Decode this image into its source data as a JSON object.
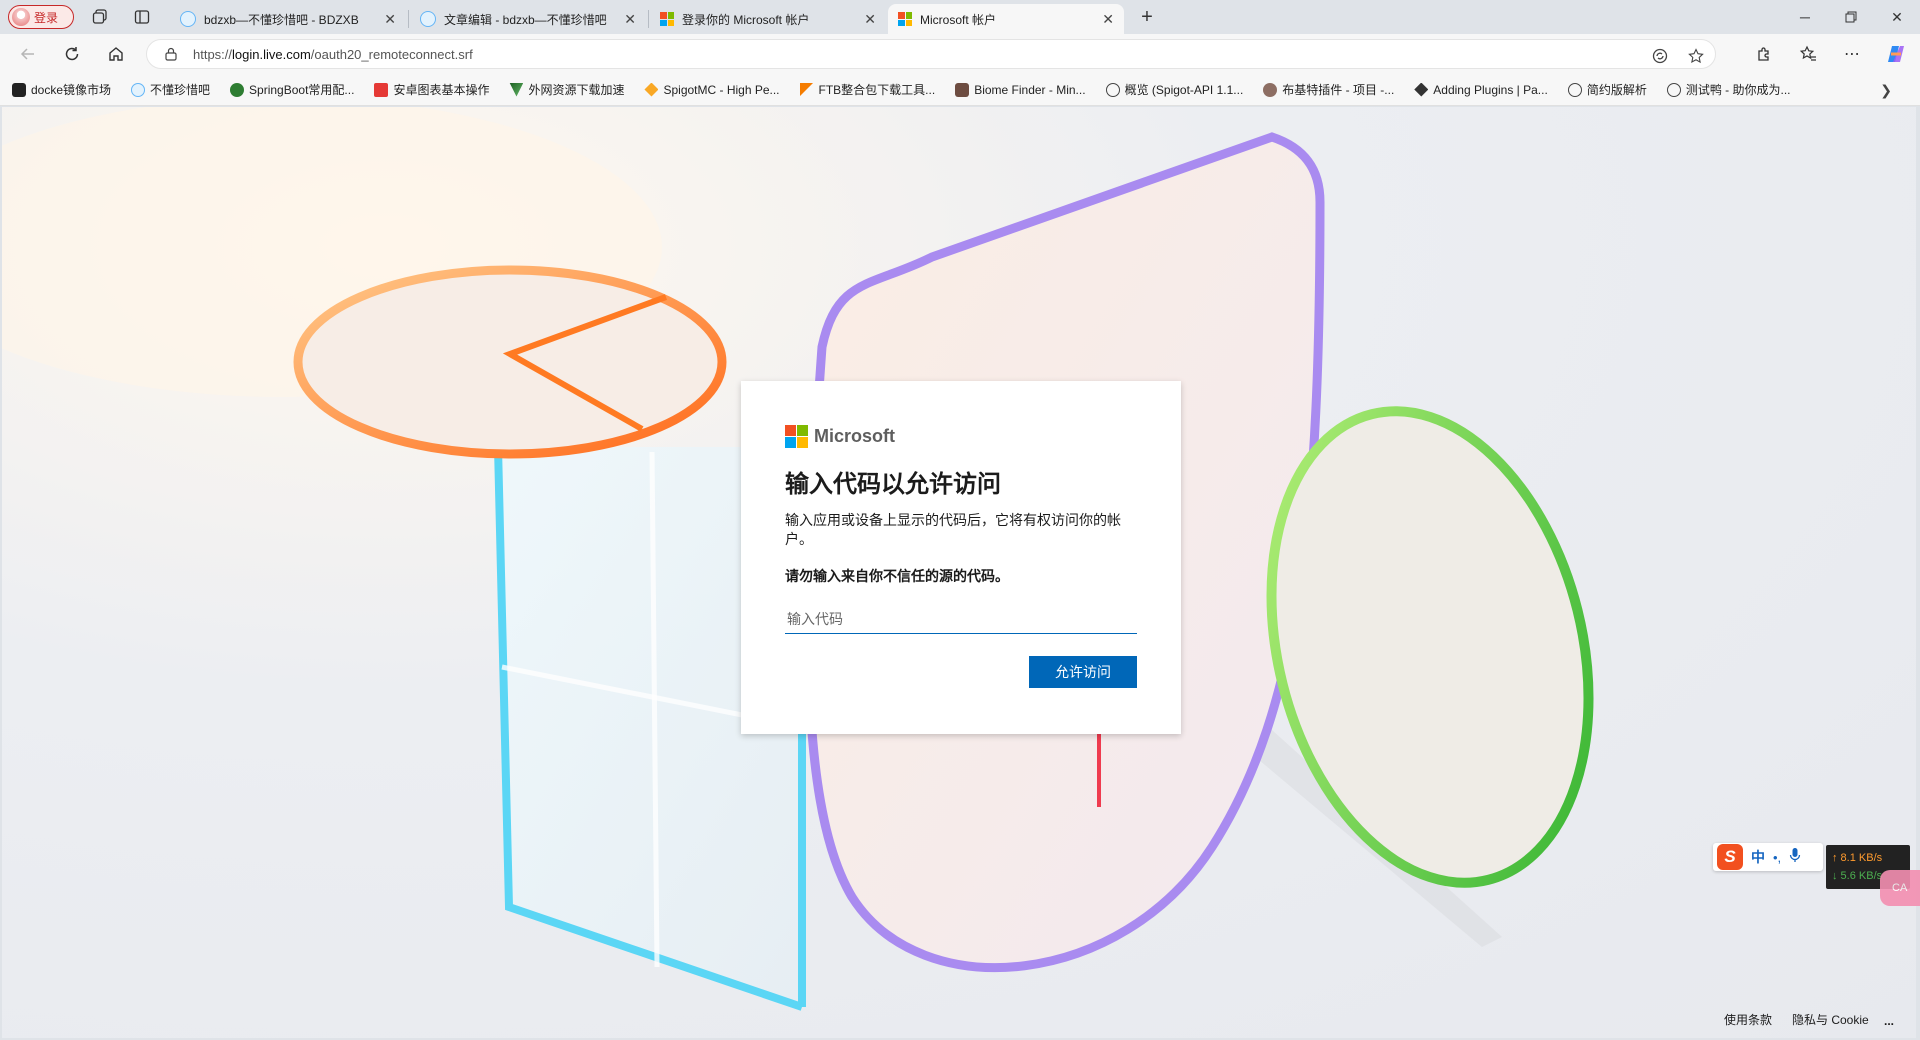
{
  "browser": {
    "profile_label": "登录",
    "tabs": [
      {
        "title": "bdzxb—不懂珍惜吧 - BDZXB",
        "favicon": "bird-icon"
      },
      {
        "title": "文章编辑 - bdzxb—不懂珍惜吧",
        "favicon": "bird-icon"
      },
      {
        "title": "登录你的 Microsoft 帐户",
        "favicon": "microsoft-logo"
      },
      {
        "title": "Microsoft 帐户",
        "favicon": "microsoft-logo",
        "active": true
      }
    ],
    "url_prefix": "https://",
    "url_host": "login.live.com",
    "url_path": "/oauth20_remoteconnect.srf",
    "favorites": [
      {
        "label": "docke镜像市场",
        "icon": "docker-icon"
      },
      {
        "label": "不懂珍惜吧",
        "icon": "bird-icon"
      },
      {
        "label": "SpringBoot常用配...",
        "icon": "spring-icon"
      },
      {
        "label": "安卓图表基本操作",
        "icon": "c-icon"
      },
      {
        "label": "外网资源下载加速",
        "icon": "v-icon"
      },
      {
        "label": "SpigotMC - High Pe...",
        "icon": "spigot-icon"
      },
      {
        "label": "FTB整合包下载工具...",
        "icon": "ftb-icon"
      },
      {
        "label": "Biome Finder - Min...",
        "icon": "biome-icon"
      },
      {
        "label": "概览 (Spigot-API 1.1...",
        "icon": "globe-icon"
      },
      {
        "label": "布基特插件 - 项目 -...",
        "icon": "bukkit-icon"
      },
      {
        "label": "Adding Plugins | Pa...",
        "icon": "paper-icon"
      },
      {
        "label": "简约版解析",
        "icon": "globe-icon"
      },
      {
        "label": "测试鸭 - 助你成为...",
        "icon": "globe-icon"
      }
    ]
  },
  "login": {
    "brand": "Microsoft",
    "title": "输入代码以允许访问",
    "description": "输入应用或设备上显示的代码后，它将有权访问你的帐户。",
    "warning": "请勿输入来自你不信任的源的代码。",
    "code_placeholder": "输入代码",
    "code_value": "",
    "allow_button": "允许访问"
  },
  "footer": {
    "terms": "使用条款",
    "privacy": "隐私与 Cookie",
    "more": "..."
  },
  "ime": {
    "logo": "S",
    "mode": "中",
    "punct": "•,"
  },
  "netmon": {
    "up": "↑ 8.1 KB/s",
    "down": "↓ 5.6 KB/s"
  },
  "pink_tab_label": "CA",
  "colors": {
    "accent": "#0067b8",
    "ms_red": "#f25022",
    "ms_green": "#7fba00",
    "ms_blue": "#00a4ef",
    "ms_yellow": "#ffb900",
    "annotation_arrow": "#ef3b4f"
  }
}
